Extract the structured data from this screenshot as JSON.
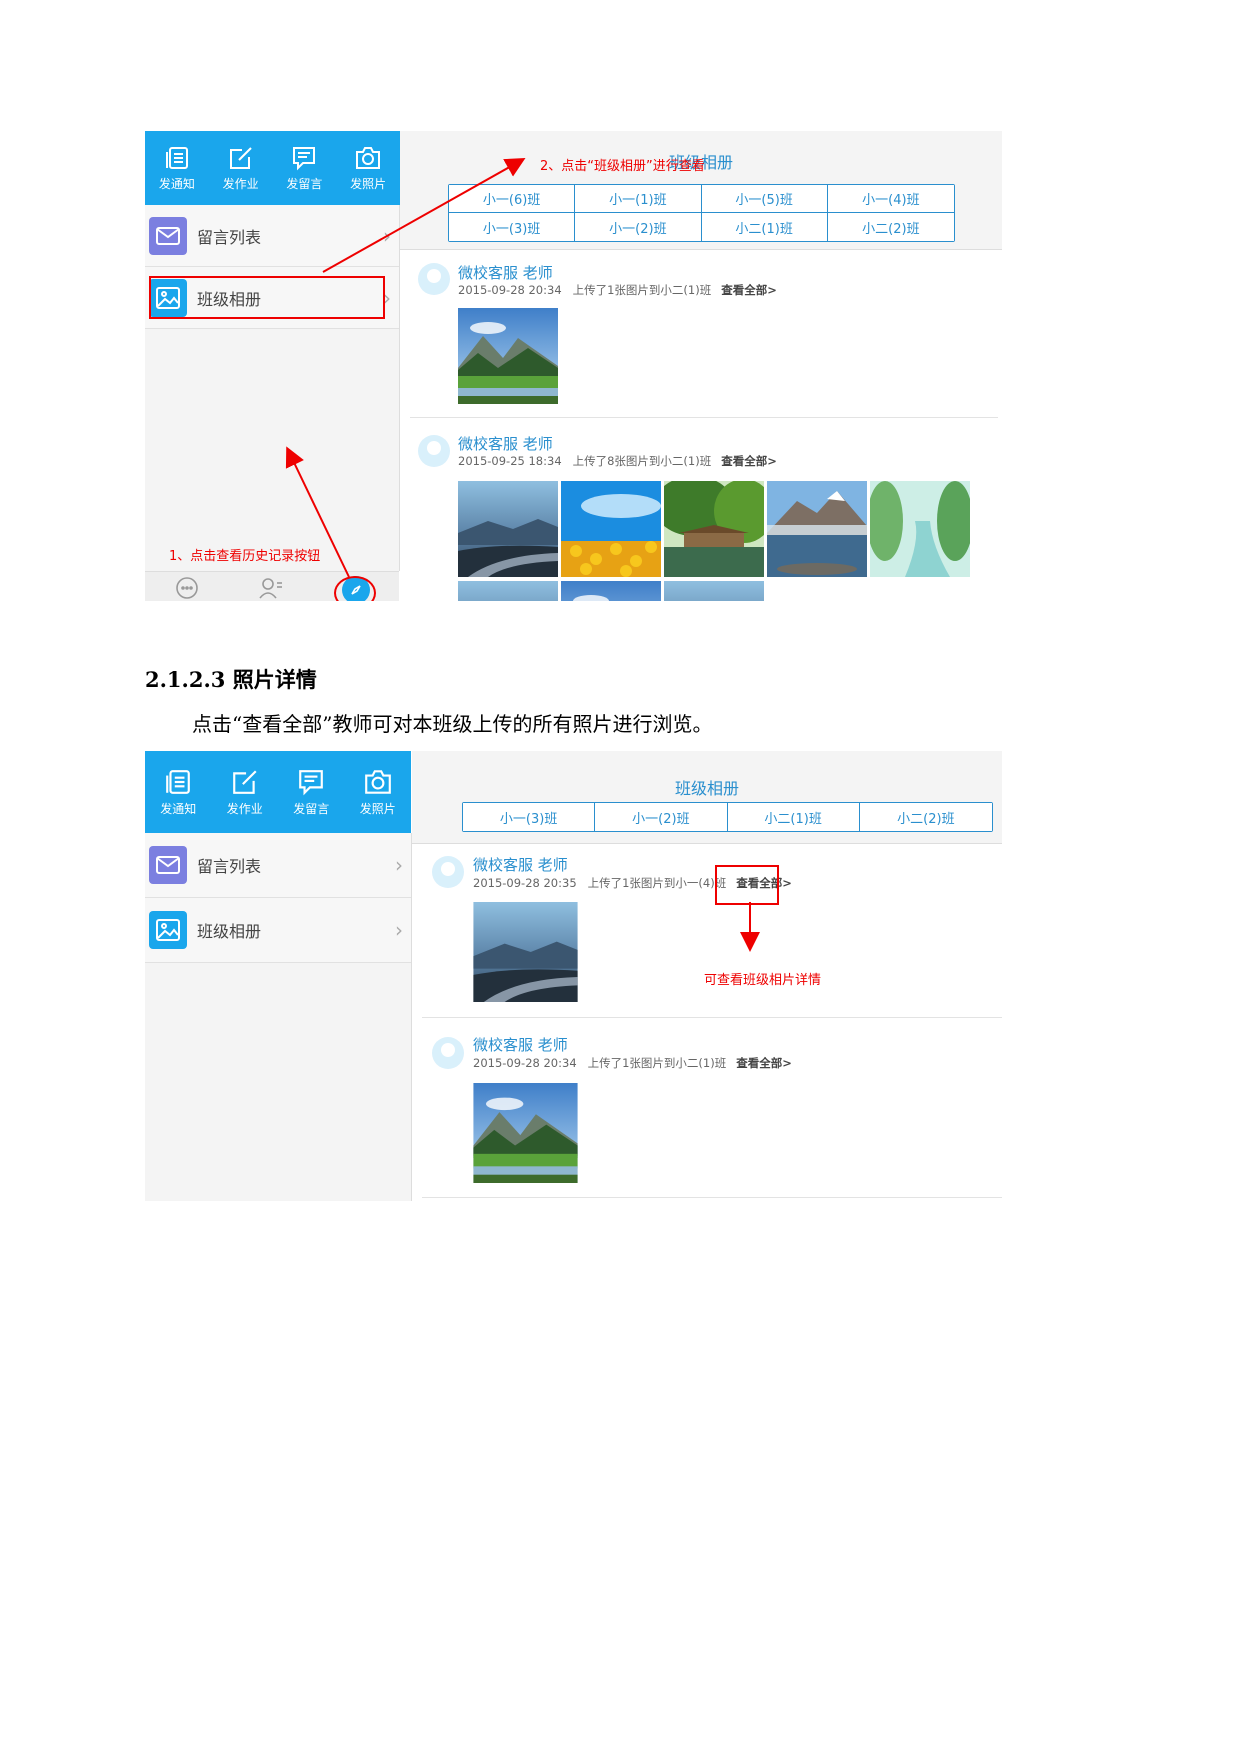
{
  "section": {
    "heading": "2.1.2.3 照片详情",
    "paragraph": "点击“查看全部”教师可对本班级上传的所有照片进行浏览。"
  },
  "toolbar_items": [
    "发通知",
    "发作业",
    "发留言",
    "发照片"
  ],
  "menu": {
    "messages": "留言列表",
    "album": "班级相册"
  },
  "album_title": "班级相册",
  "shot1": {
    "classes": [
      "小一(6)班",
      "小一(1)班",
      "小一(5)班",
      "小一(4)班",
      "小一(3)班",
      "小一(2)班",
      "小二(1)班",
      "小二(2)班"
    ],
    "posts": [
      {
        "name": "微校客服 老师",
        "time": "2015-09-28 20:34",
        "desc": "上传了1张图片到小二(1)班",
        "view_all": "查看全部>"
      },
      {
        "name": "微校客服 老师",
        "time": "2015-09-25 18:34",
        "desc": "上传了8张图片到小二(1)班",
        "view_all": "查看全部>"
      }
    ],
    "annotation_history": "1、点击查看历史记录按钮",
    "annotation_album": "2、点击“班级相册”进行查看"
  },
  "shot2": {
    "classes": [
      "小一(3)班",
      "小一(2)班",
      "小二(1)班",
      "小二(2)班"
    ],
    "posts": [
      {
        "name": "微校客服 老师",
        "time": "2015-09-28 20:35",
        "desc": "上传了1张图片到小一(4)班",
        "view_all": "查看全部>"
      },
      {
        "name": "微校客服 老师",
        "time": "2015-09-28 20:34",
        "desc": "上传了1张图片到小二(1)班",
        "view_all": "查看全部>"
      }
    ],
    "annotation_detail": "可查看班级相片详情"
  },
  "colors": {
    "toolbar": "#1aa6ec",
    "link": "#2a8fce",
    "annotation": "#e00000"
  },
  "icons": [
    "notice-icon",
    "homework-icon",
    "message-icon",
    "camera-icon",
    "mail-icon",
    "image-icon",
    "chat-icon",
    "contacts-icon",
    "compass-icon"
  ]
}
